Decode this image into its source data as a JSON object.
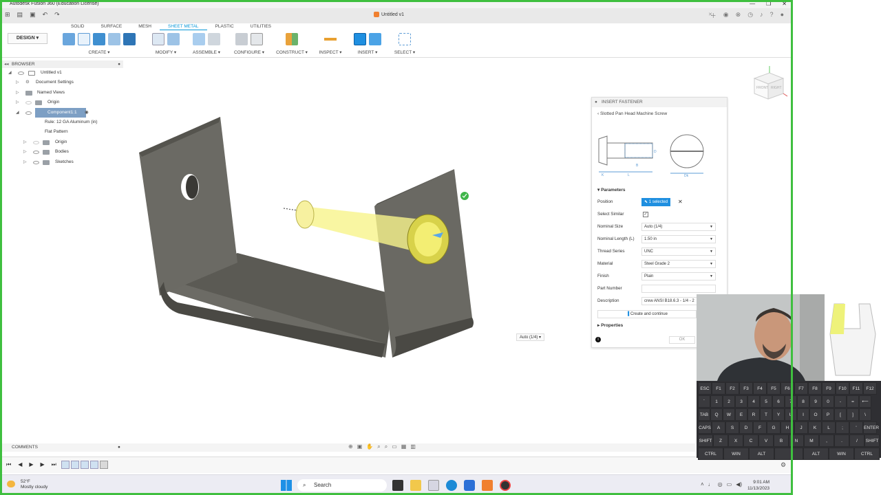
{
  "app_title": "Autodesk Fusion 360 (Education License)",
  "document_tab": "Untitled v1",
  "workspace_button": "DESIGN ▾",
  "workspace_tabs": [
    "SOLID",
    "SURFACE",
    "MESH",
    "SHEET METAL",
    "PLASTIC",
    "UTILITIES"
  ],
  "active_tab": "SHEET METAL",
  "toolbar_groups": [
    "CREATE ▾",
    "MODIFY ▾",
    "ASSEMBLE ▾",
    "CONFIGURE ▾",
    "CONSTRUCT ▾",
    "INSPECT ▾",
    "INSERT ▾",
    "SELECT ▾"
  ],
  "browser": {
    "title": "BROWSER",
    "items": [
      {
        "label": "Untitled v1"
      },
      {
        "label": "Document Settings"
      },
      {
        "label": "Named Views"
      },
      {
        "label": "Origin"
      },
      {
        "label": "Component1:1"
      },
      {
        "label": "Rule: 12 GA Aluminum (in)"
      },
      {
        "label": "Flat Pattern"
      },
      {
        "label": "Origin"
      },
      {
        "label": "Bodies"
      },
      {
        "label": "Sketches"
      }
    ]
  },
  "viewport": {
    "inline_dropdown": "Auto (1/4) ▾"
  },
  "fastener_panel": {
    "title": "INSERT FASTENER",
    "breadcrumb": "‹ Slotted Pan Head Machine Screw",
    "section_parameters": "Parameters",
    "section_properties": "Properties",
    "diagram_labels": {
      "k": "K",
      "l": "L",
      "b": "B",
      "d": "D",
      "dk": "Dk"
    },
    "fields": [
      {
        "label": "Position",
        "value": "1 selected"
      },
      {
        "label": "Select Similar",
        "value": ""
      },
      {
        "label": "Nominal Size",
        "value": "Auto (1/4)"
      },
      {
        "label": "Nominal Length (L)",
        "value": "1.50 in"
      },
      {
        "label": "Thread Series",
        "value": "UNC"
      },
      {
        "label": "Material",
        "value": "Steel Grade 2"
      },
      {
        "label": "Finish",
        "value": "Plain"
      },
      {
        "label": "Part Number",
        "value": ""
      },
      {
        "label": "Description",
        "value": "crew ANSI B18.6.3 - 1/4 - 2"
      }
    ],
    "create_continue": "Create and continue",
    "ok": "OK"
  },
  "comments_label": "COMMENTS",
  "taskbar": {
    "weather_temp": "52°F",
    "weather_desc": "Mostly cloudy",
    "search": "Search",
    "time": "9:01 AM",
    "date": "11/13/2023"
  },
  "keyboard": {
    "rows": [
      [
        "ESC",
        "F1",
        "F2",
        "F3",
        "F4",
        "F5",
        "F6",
        "F7",
        "F8",
        "F9",
        "F10",
        "F11",
        "F12"
      ],
      [
        "`",
        "1",
        "2",
        "3",
        "4",
        "5",
        "6",
        "7",
        "8",
        "9",
        "0",
        "-",
        "=",
        "⟵"
      ],
      [
        "TAB",
        "Q",
        "W",
        "E",
        "R",
        "T",
        "Y",
        "U",
        "I",
        "O",
        "P",
        "[",
        "]",
        "\\"
      ],
      [
        "CAPS",
        "A",
        "S",
        "D",
        "F",
        "G",
        "H",
        "J",
        "K",
        "L",
        ";",
        "'",
        "ENTER"
      ],
      [
        "SHIFT",
        "Z",
        "X",
        "C",
        "V",
        "B",
        "N",
        "M",
        ",",
        ".",
        "/",
        "SHIFT"
      ],
      [
        "CTRL",
        "WIN",
        "ALT",
        "",
        "ALT",
        "WIN",
        "CTRL"
      ]
    ]
  },
  "viewcube_labels": {
    "front": "FRONT",
    "right": "RIGHT"
  },
  "colors": {
    "accent": "#0696d7",
    "frame": "#3fbf3f",
    "selected": "#1f8fe0"
  }
}
